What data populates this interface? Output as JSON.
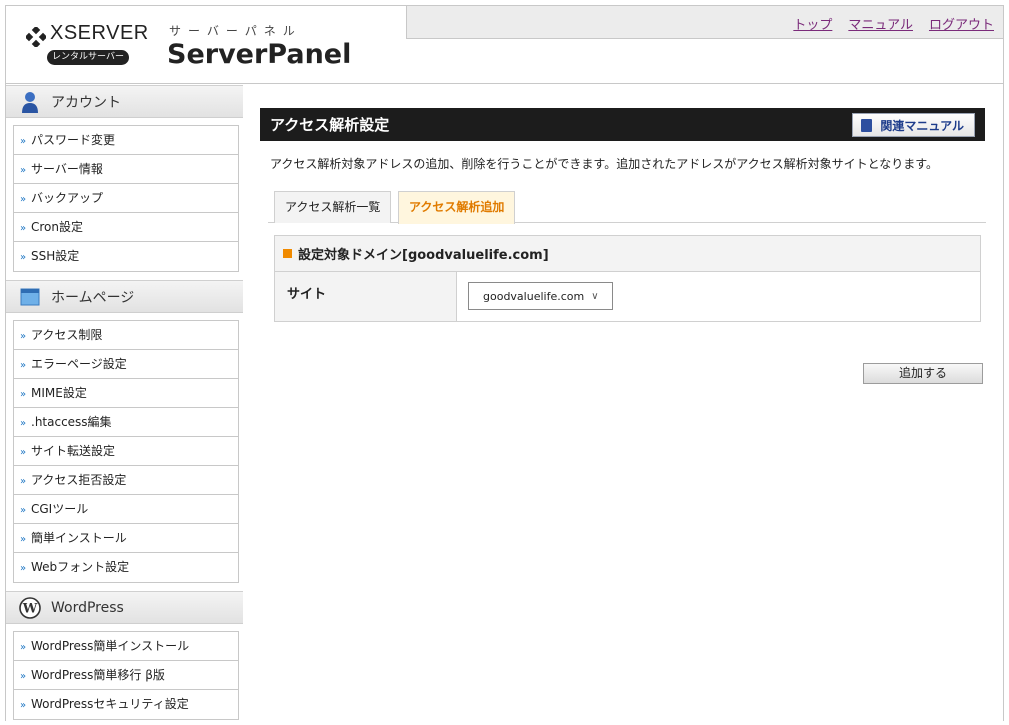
{
  "header": {
    "logo_text": "XSERVER",
    "logo_sub": "レンタルサーバー",
    "panel_kana": "サーバーパネル",
    "panel_title": "ServerPanel",
    "links": [
      "トップ",
      "マニュアル",
      "ログアウト"
    ]
  },
  "sidebar": {
    "sections": [
      {
        "title": "アカウント",
        "icon": "user-icon",
        "items": [
          "パスワード変更",
          "サーバー情報",
          "バックアップ",
          "Cron設定",
          "SSH設定"
        ]
      },
      {
        "title": "ホームページ",
        "icon": "homepage-icon",
        "items": [
          "アクセス制限",
          "エラーページ設定",
          "MIME設定",
          ".htaccess編集",
          "サイト転送設定",
          "アクセス拒否設定",
          "CGIツール",
          "簡単インストール",
          "Webフォント設定"
        ]
      },
      {
        "title": "WordPress",
        "icon": "wordpress-icon",
        "items": [
          "WordPress簡単インストール",
          "WordPress簡単移行 β版",
          "WordPressセキュリティ設定"
        ]
      }
    ]
  },
  "main": {
    "title": "アクセス解析設定",
    "manual_button": "関連マニュアル",
    "description": "アクセス解析対象アドレスの追加、削除を行うことができます。追加されたアドレスがアクセス解析対象サイトとなります。",
    "tabs": [
      "アクセス解析一覧",
      "アクセス解析追加"
    ],
    "active_tab": 1,
    "form": {
      "header": "設定対象ドメイン[goodvaluelife.com]",
      "row_label": "サイト",
      "select_value": "goodvaluelife.com",
      "submit_label": "追加する"
    }
  },
  "colors": {
    "accent_orange": "#f08a00",
    "title_bar": "#1c1c1c",
    "link": "#7a2a7a",
    "arrow_blue": "#1f77c4"
  }
}
